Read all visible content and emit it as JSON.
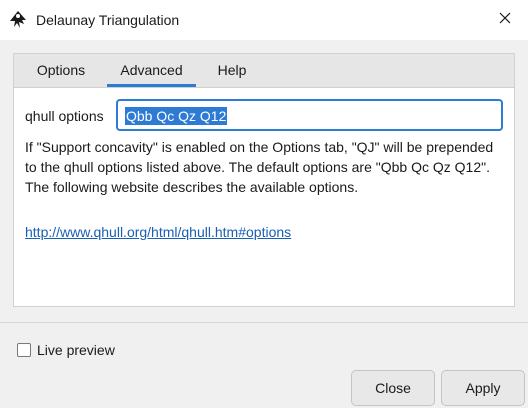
{
  "window": {
    "title": "Delaunay Triangulation",
    "app_icon": "inkscape-icon",
    "close_icon": "close-icon"
  },
  "tabs": [
    {
      "label": "Options",
      "active": false
    },
    {
      "label": "Advanced",
      "active": true
    },
    {
      "label": "Help",
      "active": false
    }
  ],
  "advanced": {
    "field_label": "qhull options",
    "field_value": "Qbb Qc Qz Q12",
    "description": "If \"Support concavity\" is enabled on the Options tab, \"QJ\" will be prepended to the qhull options listed above. The default options are \"Qbb Qc Qz Q12\". The following website describes the available options.",
    "link": "http://www.qhull.org/html/qhull.htm#options"
  },
  "footer": {
    "live_preview_label": "Live preview",
    "live_preview_checked": false,
    "close_label": "Close",
    "apply_label": "Apply"
  },
  "colors": {
    "accent": "#2e7bd6",
    "link": "#1a5fb4"
  }
}
